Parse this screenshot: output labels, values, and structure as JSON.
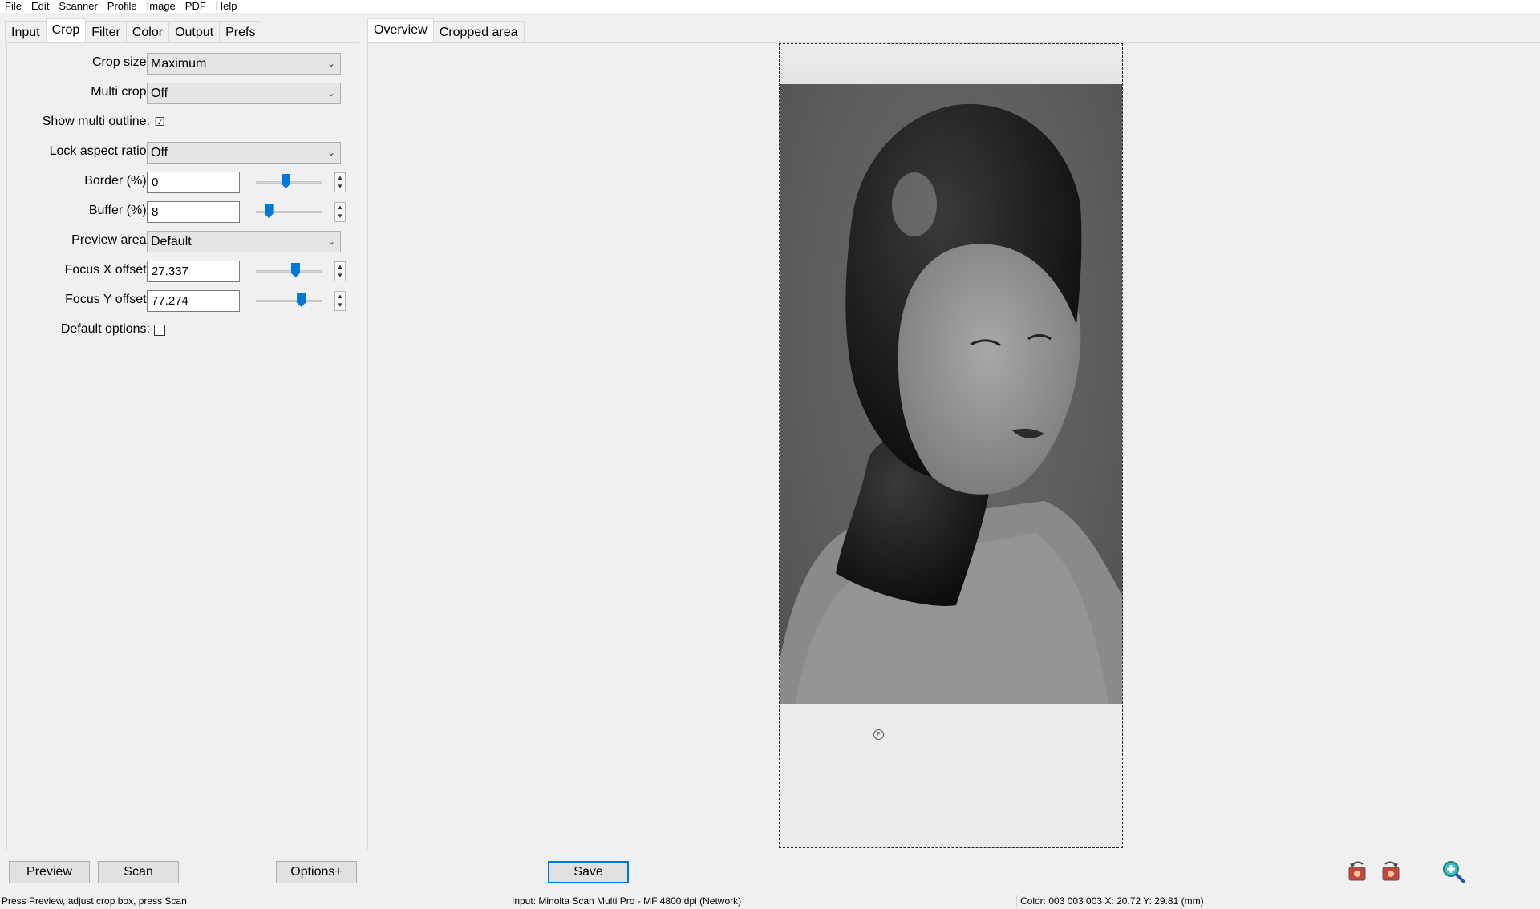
{
  "menu": [
    "File",
    "Edit",
    "Scanner",
    "Profile",
    "Image",
    "PDF",
    "Help"
  ],
  "left_tabs": [
    "Input",
    "Crop",
    "Filter",
    "Color",
    "Output",
    "Prefs"
  ],
  "active_left_tab": "Crop",
  "crop": {
    "crop_size": {
      "label": "Crop size:",
      "value": "Maximum"
    },
    "multi_crop": {
      "label": "Multi crop:",
      "value": "Off"
    },
    "show_multi_outline": {
      "label": "Show multi outline:",
      "checked": true,
      "check_glyph": "☑"
    },
    "lock_aspect_ratio": {
      "label": "Lock aspect ratio:",
      "value": "Off"
    },
    "border": {
      "label": "Border (%):",
      "value": "0",
      "slider_level": 0.45
    },
    "buffer": {
      "label": "Buffer (%):",
      "value": "8",
      "slider_level": 0.15
    },
    "preview_area": {
      "label": "Preview area:",
      "value": "Default"
    },
    "focus_x": {
      "label": "Focus X offset:",
      "value": "27.337",
      "slider_level": 0.62
    },
    "focus_y": {
      "label": "Focus Y offset:",
      "value": "77.274",
      "slider_level": 0.72
    },
    "default_options": {
      "label": "Default options:",
      "checked": false
    }
  },
  "right_tabs": [
    "Overview",
    "Cropped area"
  ],
  "active_right_tab": "Overview",
  "buttons": {
    "preview": "Preview",
    "scan": "Scan",
    "options": "Options+",
    "save": "Save"
  },
  "icons": [
    "rotate-left-icon",
    "rotate-right-icon",
    "zoom-in-icon"
  ],
  "status": {
    "hint": "Press Preview, adjust crop box, press Scan",
    "input": "Input: Minolta Scan Multi Pro - MF 4800 dpi (Network)",
    "color": "Color: 003 003 003   X:  20.72   Y:  29.81 (mm)"
  },
  "accent_color": "#0078d7"
}
